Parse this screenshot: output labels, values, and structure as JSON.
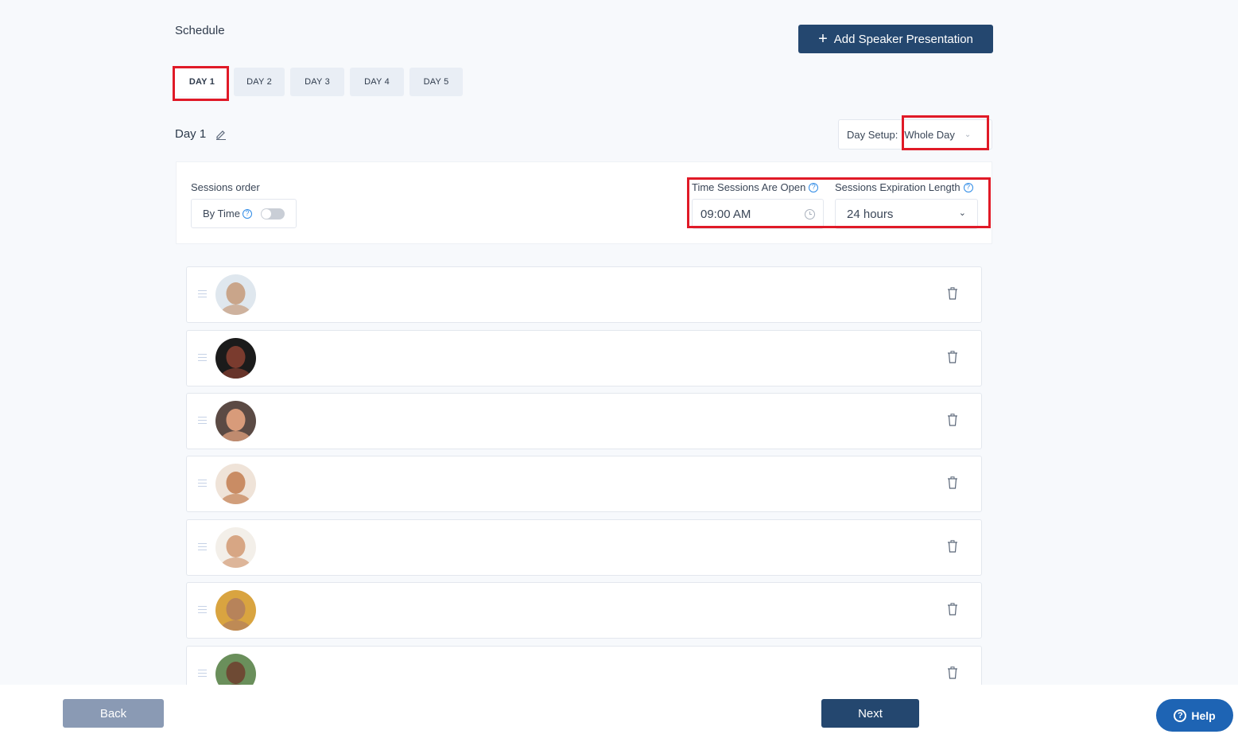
{
  "header": {
    "title": "Schedule",
    "add_button_label": "Add Speaker Presentation",
    "add_icon": "plus-icon"
  },
  "tabs": [
    {
      "label": "DAY 1",
      "active": true
    },
    {
      "label": "DAY 2",
      "active": false
    },
    {
      "label": "DAY 3",
      "active": false
    },
    {
      "label": "DAY 4",
      "active": false
    },
    {
      "label": "DAY 5",
      "active": false
    }
  ],
  "day": {
    "title": "Day 1",
    "edit_icon": "pencil-icon"
  },
  "day_setup": {
    "label": "Day Setup:",
    "value": "Whole Day"
  },
  "settings": {
    "sessions_order_label": "Sessions order",
    "by_time_label": "By Time",
    "by_time_enabled": false,
    "time_open_label": "Time Sessions Are Open",
    "time_open_value": "09:00 AM",
    "expiration_label": "Sessions Expiration Length",
    "expiration_value": "24 hours"
  },
  "sessions": [
    {
      "avatar_color": "#c9a58a",
      "avatar_bg": "#dfe7ee"
    },
    {
      "avatar_color": "#7a3b2e",
      "avatar_bg": "#1b1b1b"
    },
    {
      "avatar_color": "#d89b7a",
      "avatar_bg": "#5b4a44"
    },
    {
      "avatar_color": "#c98c64",
      "avatar_bg": "#efe3d8"
    },
    {
      "avatar_color": "#d7a684",
      "avatar_bg": "#f3efe9"
    },
    {
      "avatar_color": "#b7835a",
      "avatar_bg": "#d9a440"
    },
    {
      "avatar_color": "#6e4a34",
      "avatar_bg": "#6a8f5b"
    }
  ],
  "footer": {
    "back_label": "Back",
    "next_label": "Next",
    "help_label": "Help"
  },
  "colors": {
    "primary": "#24476f",
    "highlight": "#e01a27",
    "help": "#1e64b4",
    "back": "#8a9ab4"
  }
}
